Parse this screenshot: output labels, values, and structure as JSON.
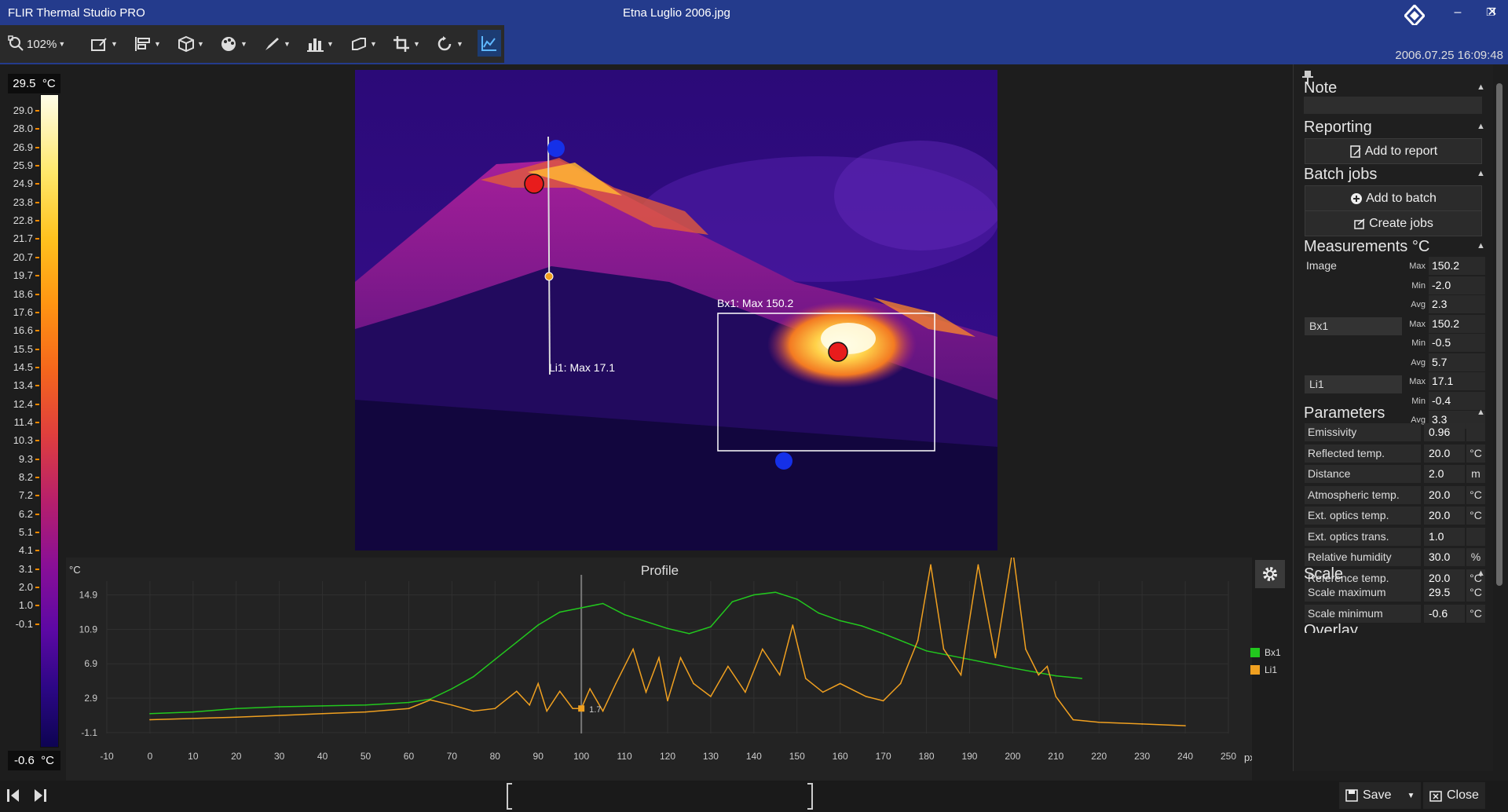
{
  "app_title": "FLIR Thermal Studio PRO",
  "document_title": "Etna Luglio 2006.jpg",
  "window_buttons": {
    "minimize": "–",
    "restore": "❐",
    "close": "✕"
  },
  "toolbar": {
    "zoom_value": "102%",
    "icons": [
      "zoom-icon",
      "edit-image-icon",
      "align-icon",
      "3d-box-icon",
      "palette-icon",
      "pen-icon",
      "histogram-icon",
      "transform-icon",
      "crop-icon",
      "rotate-icon",
      "profile-chart-icon"
    ]
  },
  "timestamp": "2006.07.25 16:09:48",
  "scale": {
    "max": "29.5",
    "min": "-0.6",
    "unit": "°C",
    "ticks": [
      "29.0",
      "28.0",
      "26.9",
      "25.9",
      "24.9",
      "23.8",
      "22.8",
      "21.7",
      "20.7",
      "19.7",
      "18.6",
      "17.6",
      "16.6",
      "15.5",
      "14.5",
      "13.4",
      "12.4",
      "11.4",
      "10.3",
      "9.3",
      "8.2",
      "7.2",
      "6.2",
      "5.1",
      "4.1",
      "3.1",
      "2.0",
      "1.0",
      "-0.1"
    ]
  },
  "image_overlay": {
    "box_label": "Bx1:  Max 150.2",
    "line_label": "Li1:  Max 17.1"
  },
  "profile": {
    "title": "Profile",
    "y_unit": "°C",
    "x_unit": "px",
    "cursor_value": "1.7",
    "legend": [
      {
        "name": "Bx1",
        "color": "#22c81e"
      },
      {
        "name": "Li1",
        "color": "#f0a020"
      }
    ]
  },
  "chart_data": {
    "type": "line",
    "title": "Profile",
    "xlabel": "px",
    "ylabel": "°C",
    "xlim": [
      -10,
      250
    ],
    "ylim": [
      -1.2,
      16.5
    ],
    "x_ticks": [
      "-10",
      "0",
      "10",
      "20",
      "30",
      "40",
      "50",
      "60",
      "70",
      "80",
      "90",
      "100",
      "110",
      "120",
      "130",
      "140",
      "150",
      "160",
      "170",
      "180",
      "190",
      "200",
      "210",
      "220",
      "230",
      "240",
      "250"
    ],
    "y_ticks": [
      "14.9",
      "10.9",
      "6.9",
      "2.9",
      "-1.1"
    ],
    "cursor_x": 100,
    "series": [
      {
        "name": "Bx1",
        "color": "#22c81e",
        "points": [
          [
            0,
            1.1
          ],
          [
            10,
            1.3
          ],
          [
            20,
            1.7
          ],
          [
            30,
            1.9
          ],
          [
            40,
            2.0
          ],
          [
            50,
            2.1
          ],
          [
            60,
            2.4
          ],
          [
            65,
            2.8
          ],
          [
            70,
            4.0
          ],
          [
            75,
            5.4
          ],
          [
            80,
            7.4
          ],
          [
            85,
            9.4
          ],
          [
            90,
            11.4
          ],
          [
            95,
            12.9
          ],
          [
            100,
            13.4
          ],
          [
            105,
            13.9
          ],
          [
            110,
            12.6
          ],
          [
            120,
            11.0
          ],
          [
            125,
            10.4
          ],
          [
            130,
            11.2
          ],
          [
            135,
            14.1
          ],
          [
            140,
            14.9
          ],
          [
            145,
            15.2
          ],
          [
            150,
            14.4
          ],
          [
            155,
            12.8
          ],
          [
            160,
            11.9
          ],
          [
            165,
            11.3
          ],
          [
            170,
            10.4
          ],
          [
            175,
            9.4
          ],
          [
            180,
            8.4
          ],
          [
            190,
            7.4
          ],
          [
            200,
            6.4
          ],
          [
            210,
            5.5
          ],
          [
            216,
            5.2
          ]
        ]
      },
      {
        "name": "Li1",
        "color": "#f0a020",
        "points": [
          [
            0,
            0.4
          ],
          [
            20,
            0.7
          ],
          [
            40,
            1.1
          ],
          [
            50,
            1.3
          ],
          [
            60,
            1.7
          ],
          [
            65,
            2.7
          ],
          [
            70,
            2.1
          ],
          [
            75,
            1.4
          ],
          [
            80,
            1.7
          ],
          [
            85,
            3.7
          ],
          [
            88,
            2.1
          ],
          [
            90,
            4.6
          ],
          [
            92,
            1.4
          ],
          [
            95,
            3.7
          ],
          [
            98,
            1.7
          ],
          [
            100,
            1.7
          ],
          [
            102,
            4.0
          ],
          [
            105,
            1.4
          ],
          [
            108,
            4.6
          ],
          [
            112,
            8.6
          ],
          [
            115,
            3.6
          ],
          [
            118,
            7.6
          ],
          [
            120,
            2.6
          ],
          [
            123,
            7.6
          ],
          [
            126,
            4.6
          ],
          [
            130,
            3.1
          ],
          [
            134,
            6.6
          ],
          [
            138,
            3.6
          ],
          [
            142,
            8.6
          ],
          [
            146,
            5.6
          ],
          [
            149,
            11.4
          ],
          [
            152,
            5.2
          ],
          [
            156,
            3.6
          ],
          [
            160,
            4.6
          ],
          [
            166,
            3.1
          ],
          [
            170,
            2.6
          ],
          [
            174,
            4.6
          ],
          [
            178,
            9.6
          ],
          [
            181,
            18.4
          ],
          [
            184,
            8.6
          ],
          [
            188,
            5.6
          ],
          [
            192,
            18.4
          ],
          [
            196,
            7.6
          ],
          [
            200,
            21.0
          ],
          [
            203,
            8.6
          ],
          [
            206,
            5.6
          ],
          [
            208,
            6.6
          ],
          [
            210,
            3.1
          ],
          [
            214,
            0.4
          ],
          [
            220,
            0.1
          ],
          [
            230,
            -0.1
          ],
          [
            240,
            -0.3
          ]
        ]
      }
    ]
  },
  "right_panel": {
    "note": {
      "title": "Note"
    },
    "reporting": {
      "title": "Reporting",
      "add_to_report": "Add to report"
    },
    "batch": {
      "title": "Batch jobs",
      "add_to_batch": "Add to batch",
      "create_jobs": "Create jobs"
    },
    "measurements": {
      "title": "Measurements °C",
      "groups": [
        {
          "name": "Image",
          "rows": [
            {
              "k": "Max",
              "v": "150.2"
            },
            {
              "k": "Min",
              "v": "-2.0"
            },
            {
              "k": "Avg",
              "v": "2.3"
            }
          ]
        },
        {
          "name": "Bx1",
          "rows": [
            {
              "k": "Max",
              "v": "150.2"
            },
            {
              "k": "Min",
              "v": "-0.5"
            },
            {
              "k": "Avg",
              "v": "5.7"
            }
          ]
        },
        {
          "name": "Li1",
          "rows": [
            {
              "k": "Max",
              "v": "17.1"
            },
            {
              "k": "Min",
              "v": "-0.4"
            },
            {
              "k": "Avg",
              "v": "3.3"
            }
          ]
        }
      ]
    },
    "parameters": {
      "title": "Parameters",
      "rows": [
        {
          "n": "Emissivity",
          "v": "0.96",
          "u": ""
        },
        {
          "n": "Reflected temp.",
          "v": "20.0",
          "u": "°C"
        },
        {
          "n": "Distance",
          "v": "2.0",
          "u": "m"
        },
        {
          "n": "Atmospheric temp.",
          "v": "20.0",
          "u": "°C"
        },
        {
          "n": "Ext. optics temp.",
          "v": "20.0",
          "u": "°C"
        },
        {
          "n": "Ext. optics trans.",
          "v": "1.0",
          "u": ""
        },
        {
          "n": "Relative humidity",
          "v": "30.0",
          "u": "%"
        },
        {
          "n": "Reference temp.",
          "v": "20.0",
          "u": "°C"
        }
      ]
    },
    "scale_section": {
      "title": "Scale",
      "rows": [
        {
          "n": "Scale maximum",
          "v": "29.5",
          "u": "°C"
        },
        {
          "n": "Scale minimum",
          "v": "-0.6",
          "u": "°C"
        }
      ]
    },
    "overlay": {
      "title": "Overlay"
    }
  },
  "bottom": {
    "save": "Save",
    "close": "Close"
  }
}
